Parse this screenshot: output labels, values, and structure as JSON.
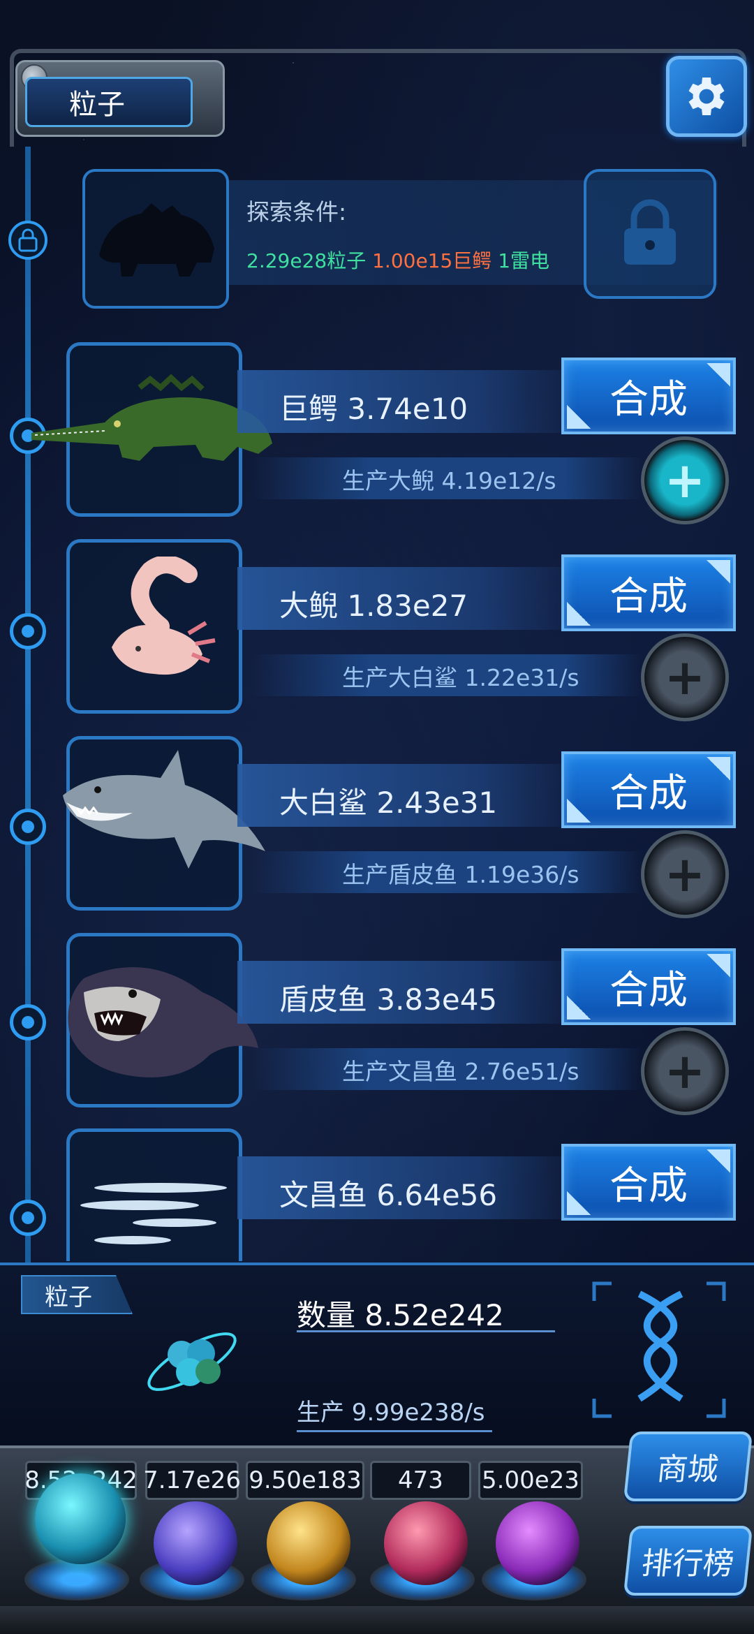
{
  "header": {
    "resource_title": "粒子"
  },
  "locked": {
    "condition_label": "探索条件:",
    "req_particles": "2.29e28粒子",
    "req_crocodile": "1.00e15巨鳄",
    "req_thunder": "1雷电"
  },
  "rows": [
    {
      "name": "巨鳄 3.74e10",
      "production": "生产大鲵 4.19e12/s",
      "synth_label": "合成",
      "plus_active": true
    },
    {
      "name": "大鲵 1.83e27",
      "production": "生产大白鲨 1.22e31/s",
      "synth_label": "合成",
      "plus_active": false
    },
    {
      "name": "大白鲨 2.43e31",
      "production": "生产盾皮鱼 1.19e36/s",
      "synth_label": "合成",
      "plus_active": false
    },
    {
      "name": "盾皮鱼 3.83e45",
      "production": "生产文昌鱼 2.76e51/s",
      "synth_label": "合成",
      "plus_active": false
    },
    {
      "name": "文昌鱼 6.64e56",
      "production": "",
      "synth_label": "合成",
      "plus_active": false
    }
  ],
  "resource_panel": {
    "tag": "粒子",
    "count": "数量 8.52e242",
    "rate": "生产 9.99e238/s"
  },
  "inventory": {
    "values": [
      "8.52e242",
      "7.17e26",
      "9.50e183",
      "473",
      "5.00e23"
    ],
    "shop_label": "商城",
    "rank_label": "排行榜"
  },
  "colors": {
    "accent": "#2b78c4",
    "button": "#1d82e6",
    "req_green": "#3fe0a0",
    "req_orange": "#ff7040"
  },
  "icons": [
    "gear-icon",
    "lock-icon",
    "plus-icon",
    "dna-icon",
    "atom-icon"
  ]
}
